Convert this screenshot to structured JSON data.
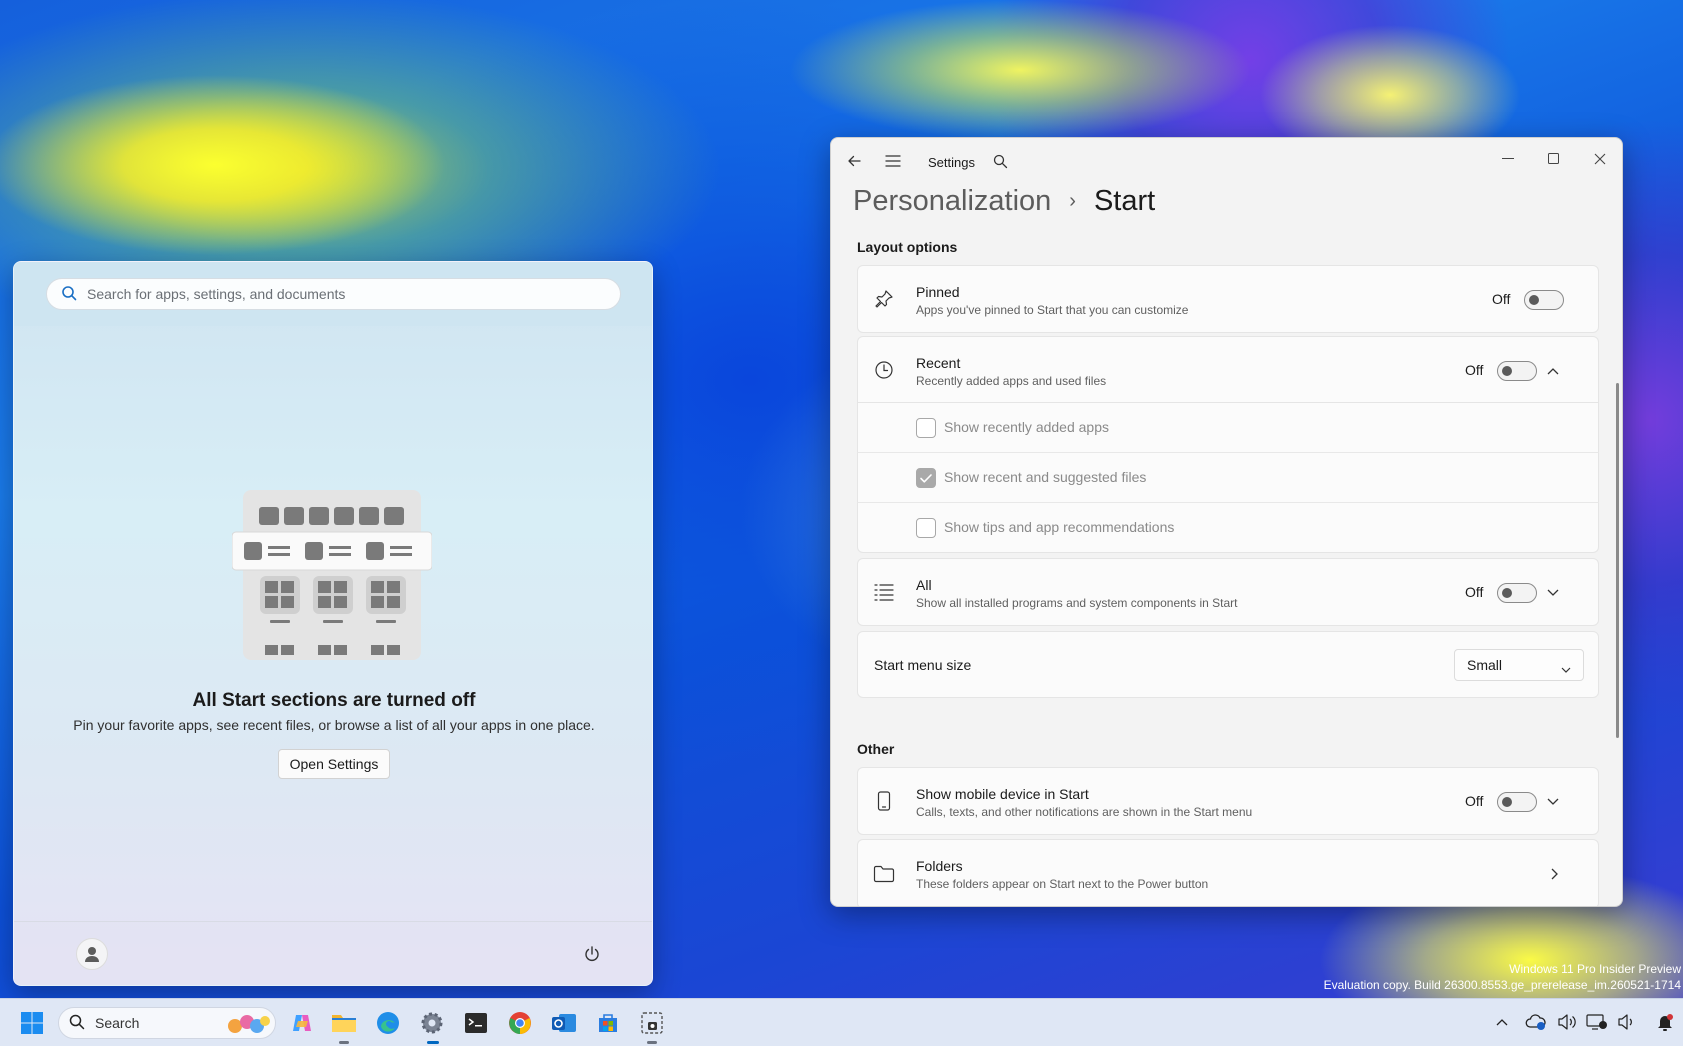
{
  "start_menu": {
    "search_placeholder": "Search for apps, settings, and documents",
    "title": "All Start sections are turned off",
    "subtitle": "Pin your favorite apps, see recent files, or browse a list of all your apps in one place.",
    "open_settings": "Open Settings"
  },
  "settings": {
    "app_title": "Settings",
    "breadcrumb_parent": "Personalization",
    "breadcrumb_separator": "›",
    "breadcrumb_current": "Start",
    "layout_section": "Layout options",
    "pinned": {
      "title": "Pinned",
      "desc": "Apps you've pinned to Start that you can customize",
      "state": "Off"
    },
    "recent": {
      "title": "Recent",
      "desc": "Recently added apps and used files",
      "state": "Off"
    },
    "recent_options": [
      {
        "label": "Show recently added apps",
        "checked": false
      },
      {
        "label": "Show recent and suggested files",
        "checked": true
      },
      {
        "label": "Show tips and app recommendations",
        "checked": false
      }
    ],
    "all": {
      "title": "All",
      "desc": "Show all installed programs and system components in Start",
      "state": "Off"
    },
    "menu_size": {
      "label": "Start menu size",
      "value": "Small"
    },
    "other_section": "Other",
    "mobile": {
      "title": "Show mobile device in Start",
      "desc": "Calls, texts, and other notifications are shown in the Start menu",
      "state": "Off"
    },
    "folders": {
      "title": "Folders",
      "desc": "These folders appear on Start next to the Power button"
    }
  },
  "watermark": {
    "line1": "Windows 11 Pro Insider Preview",
    "line2": "Evaluation copy. Build 26300.8553.ge_prerelease_im.260521-1714"
  },
  "taskbar": {
    "search_label": "Search",
    "apps": [
      "copilot-icon",
      "file-explorer-icon",
      "edge-icon",
      "settings-icon",
      "terminal-icon",
      "chrome-icon",
      "outlook-icon",
      "store-icon",
      "snipping-tool-icon"
    ]
  },
  "colors": {
    "accent": "#0067c0",
    "toggle_off": "#5a5a5a"
  }
}
